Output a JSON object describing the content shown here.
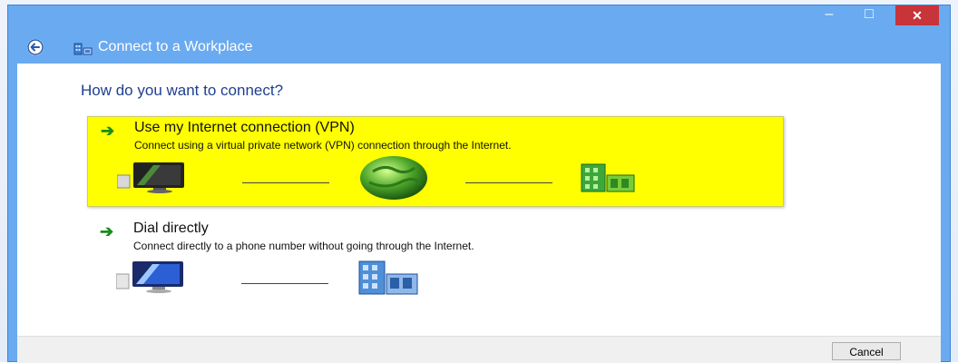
{
  "window": {
    "title": "Connect to a Workplace",
    "minimize_glyph": "–",
    "maximize_glyph": "□",
    "close_glyph": "✕"
  },
  "prompt": "How do you want to connect?",
  "options": [
    {
      "title": "Use my Internet connection (VPN)",
      "description": "Connect using a virtual private network (VPN) connection through the Internet.",
      "highlighted": true,
      "icons": [
        "computer-icon",
        "globe-icon",
        "workplace-building-icon"
      ]
    },
    {
      "title": "Dial directly",
      "description": "Connect directly to a phone number without going through the Internet.",
      "highlighted": false,
      "icons": [
        "computer-icon",
        "workplace-building-icon"
      ]
    }
  ],
  "footer": {
    "cancel_label": "Cancel"
  },
  "colors": {
    "titlebar": "#6aaaf0",
    "close_button": "#c7343a",
    "highlight": "#ffff00",
    "heading_text": "#1e3f8f",
    "arrow": "#1a8c1a"
  }
}
